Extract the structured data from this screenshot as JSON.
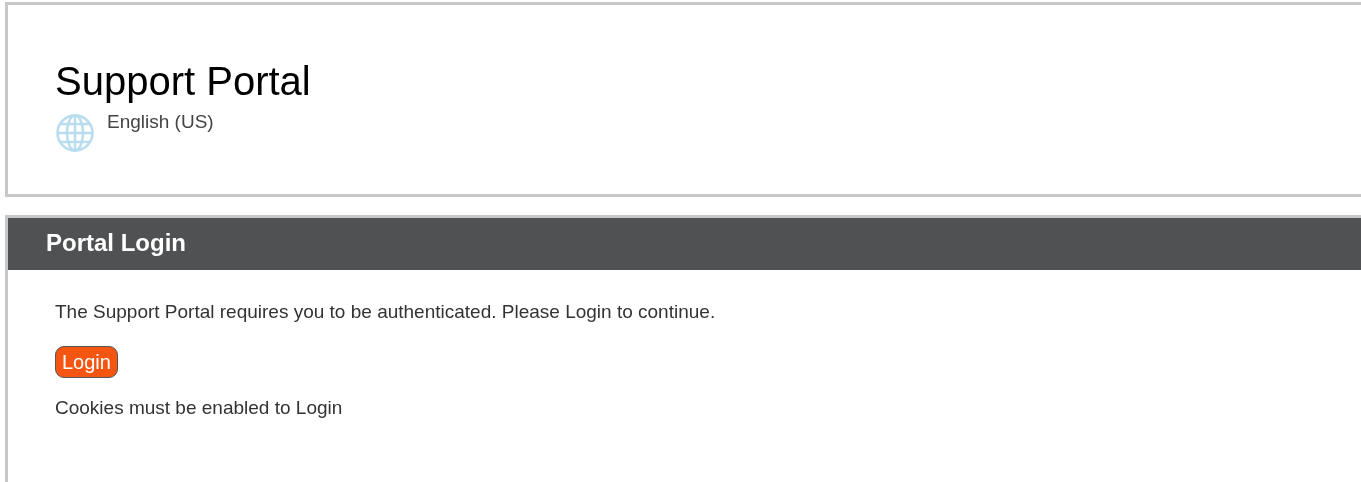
{
  "header": {
    "title": "Support Portal",
    "language": "English (US)"
  },
  "login_panel": {
    "title": "Portal Login",
    "message": "The Support Portal requires you to be authenticated. Please Login to continue.",
    "button": "Login",
    "note": "Cookies must be enabled to Login"
  }
}
